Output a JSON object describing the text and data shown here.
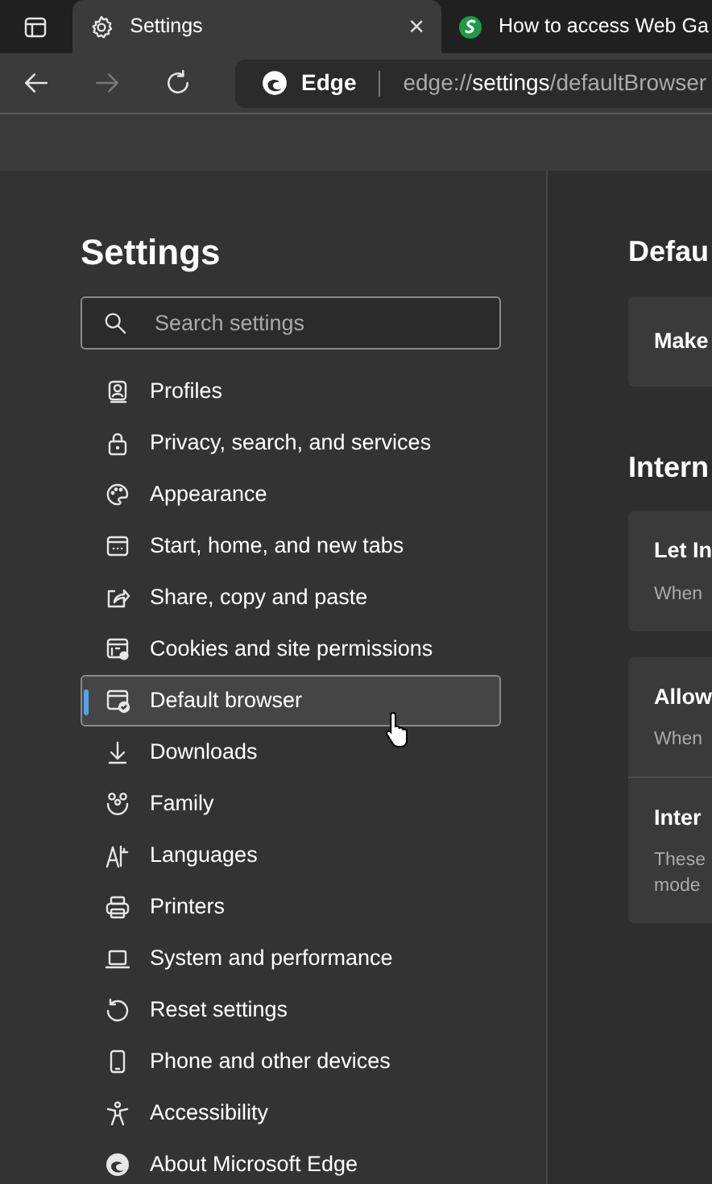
{
  "tabs": [
    {
      "title": "Settings",
      "selected": true,
      "close": "×"
    },
    {
      "title": "How to access Web Ga",
      "selected": false
    }
  ],
  "address_bar": {
    "site_label": "Edge",
    "url_prefix": "edge://",
    "url_host": "settings",
    "url_path": "/defaultBrowser"
  },
  "sidebar": {
    "title": "Settings",
    "search_placeholder": "Search settings",
    "items": [
      {
        "label": "Profiles",
        "selected": false
      },
      {
        "label": "Privacy, search, and services",
        "selected": false
      },
      {
        "label": "Appearance",
        "selected": false
      },
      {
        "label": "Start, home, and new tabs",
        "selected": false
      },
      {
        "label": "Share, copy and paste",
        "selected": false
      },
      {
        "label": "Cookies and site permissions",
        "selected": false
      },
      {
        "label": "Default browser",
        "selected": true
      },
      {
        "label": "Downloads",
        "selected": false
      },
      {
        "label": "Family",
        "selected": false
      },
      {
        "label": "Languages",
        "selected": false
      },
      {
        "label": "Printers",
        "selected": false
      },
      {
        "label": "System and performance",
        "selected": false
      },
      {
        "label": "Reset settings",
        "selected": false
      },
      {
        "label": "Phone and other devices",
        "selected": false
      },
      {
        "label": "Accessibility",
        "selected": false
      },
      {
        "label": "About Microsoft Edge",
        "selected": false
      }
    ]
  },
  "main": {
    "sections": [
      {
        "heading": "Defau",
        "cards": [
          {
            "rows": [
              {
                "title": "Make"
              }
            ]
          }
        ]
      },
      {
        "heading": "Intern",
        "cards": [
          {
            "rows": [
              {
                "title": "Let In",
                "description": [
                  "When"
                ]
              }
            ]
          },
          {
            "rows": [
              {
                "title": "Allow",
                "description": [
                  "When"
                ]
              },
              {
                "title": "Inter",
                "description": [
                  "These",
                  "mode"
                ]
              }
            ]
          }
        ]
      }
    ]
  }
}
